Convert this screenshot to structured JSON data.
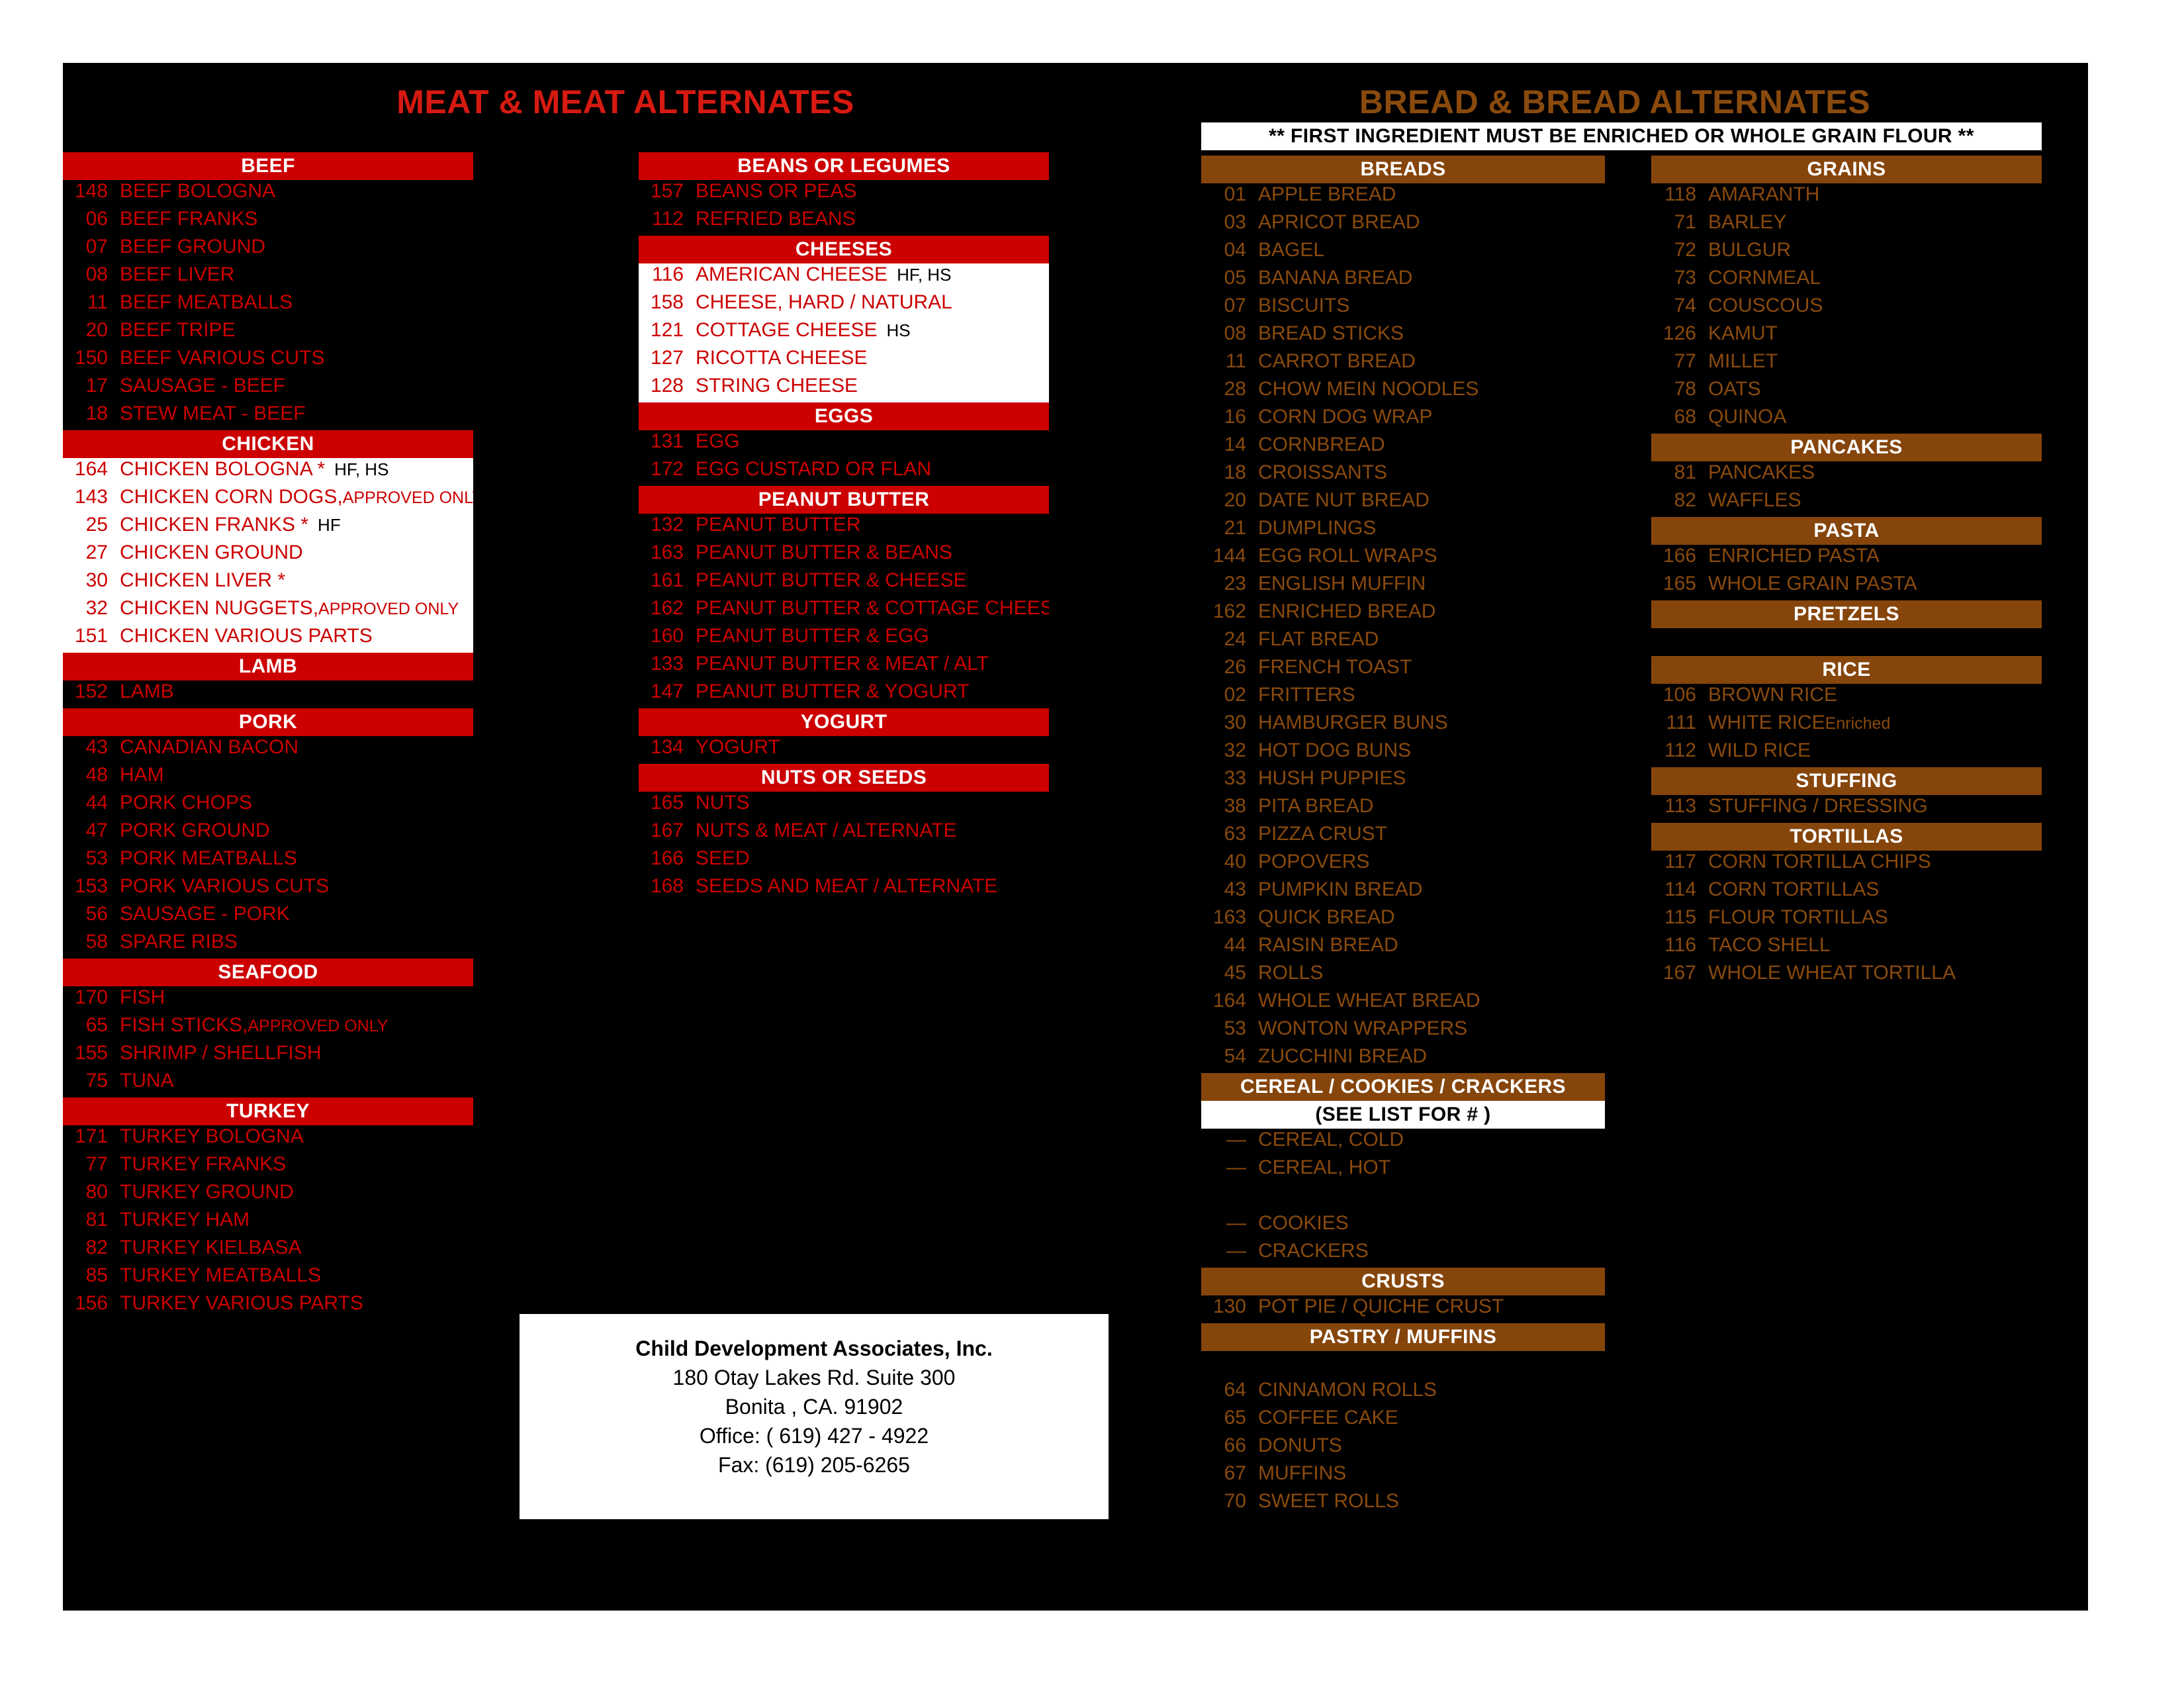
{
  "headers": {
    "meat": "MEAT & MEAT ALTERNATES",
    "bread": "BREAD & BREAD ALTERNATES",
    "bread_note": "** FIRST INGREDIENT MUST BE ENRICHED OR WHOLE GRAIN FLOUR **"
  },
  "colors": {
    "red_accent": "#cc0000",
    "red_text": "#cc0000",
    "brown_accent": "#86450b",
    "brown_text": "#8a4a0d",
    "page_background": "#000000",
    "paper": "#ffffff"
  },
  "columns": {
    "meat_left": [
      {
        "title": "BEEF",
        "style": "red",
        "white_panel": false,
        "items": [
          {
            "num": "148",
            "label": "BEEF BOLOGNA"
          },
          {
            "num": "06",
            "label": "BEEF FRANKS"
          },
          {
            "num": "07",
            "label": "BEEF GROUND"
          },
          {
            "num": "08",
            "label": "BEEF LIVER"
          },
          {
            "num": "11",
            "label": "BEEF MEATBALLS"
          },
          {
            "num": "20",
            "label": "BEEF TRIPE"
          },
          {
            "num": "150",
            "label": "BEEF VARIOUS CUTS"
          },
          {
            "num": "17",
            "label": "SAUSAGE - BEEF"
          },
          {
            "num": "18",
            "label": "STEW MEAT - BEEF"
          }
        ]
      },
      {
        "title": "CHICKEN",
        "style": "red",
        "white_panel": true,
        "items": [
          {
            "num": "164",
            "label": "CHICKEN  BOLOGNA  *",
            "note": "HF, HS"
          },
          {
            "num": "143",
            "label": "CHICKEN  CORN DOGS,",
            "small": "APPROVED ONLY"
          },
          {
            "num": "25",
            "label": "CHICKEN  FRANKS   *",
            "note": "HF"
          },
          {
            "num": "27",
            "label": "CHICKEN  GROUND"
          },
          {
            "num": "30",
            "label": "CHICKEN  LIVER *"
          },
          {
            "num": "32",
            "label": "CHICKEN  NUGGETS,",
            "small": "APPROVED ONLY"
          },
          {
            "num": "151",
            "label": "CHICKEN  VARIOUS PARTS"
          }
        ]
      },
      {
        "title": "LAMB",
        "style": "red",
        "white_panel": false,
        "items": [
          {
            "num": "152",
            "label": "LAMB"
          }
        ]
      },
      {
        "title": "PORK",
        "style": "red",
        "white_panel": false,
        "items": [
          {
            "num": "43",
            "label": "CANADIAN BACON"
          },
          {
            "num": "48",
            "label": "HAM"
          },
          {
            "num": "44",
            "label": "PORK CHOPS"
          },
          {
            "num": "47",
            "label": "PORK GROUND"
          },
          {
            "num": "53",
            "label": "PORK MEATBALLS"
          },
          {
            "num": "153",
            "label": "PORK VARIOUS CUTS"
          },
          {
            "num": "56",
            "label": "SAUSAGE - PORK"
          },
          {
            "num": "58",
            "label": "SPARE RIBS"
          }
        ]
      },
      {
        "title": "SEAFOOD",
        "style": "red",
        "white_panel": false,
        "items": [
          {
            "num": "170",
            "label": "FISH"
          },
          {
            "num": "65",
            "label": "FISH STICKS,",
            "small": "APPROVED  ONLY"
          },
          {
            "num": "155",
            "label": "SHRIMP / SHELLFISH"
          },
          {
            "num": "75",
            "label": "TUNA"
          }
        ]
      },
      {
        "title": "TURKEY",
        "style": "red",
        "white_panel": false,
        "items": [
          {
            "num": "171",
            "label": "TURKEY  BOLOGNA"
          },
          {
            "num": "77",
            "label": "TURKEY  FRANKS"
          },
          {
            "num": "80",
            "label": "TURKEY  GROUND"
          },
          {
            "num": "81",
            "label": "TURKEY  HAM"
          },
          {
            "num": "82",
            "label": "TURKEY KIELBASA"
          },
          {
            "num": "85",
            "label": "TURKEY  MEATBALLS"
          },
          {
            "num": "156",
            "label": "TURKEY  VARIOUS PARTS"
          }
        ]
      }
    ],
    "meat_middle": [
      {
        "title": "BEANS  OR  LEGUMES",
        "style": "red",
        "white_panel": false,
        "items": [
          {
            "num": "157",
            "label": "BEANS  OR  PEAS"
          },
          {
            "num": "112",
            "label": "REFRIED  BEANS"
          }
        ]
      },
      {
        "title": "CHEESES",
        "style": "red",
        "white_panel": true,
        "items": [
          {
            "num": "116",
            "label": "AMERICAN CHEESE",
            "note": "HF, HS"
          },
          {
            "num": "158",
            "label": "CHEESE,  HARD / NATURAL"
          },
          {
            "num": "121",
            "label": "COTTAGE CHEESE",
            "note": "HS"
          },
          {
            "num": "127",
            "label": "RICOTTA  CHEESE"
          },
          {
            "num": "128",
            "label": "STRING  CHEESE"
          }
        ]
      },
      {
        "title": "EGGS",
        "style": "red",
        "white_panel": false,
        "items": [
          {
            "num": "131",
            "label": "EGG"
          },
          {
            "num": "172",
            "label": "EGG  CUSTARD OR FLAN"
          }
        ]
      },
      {
        "title": "PEANUT  BUTTER",
        "style": "red",
        "white_panel": false,
        "items": [
          {
            "num": "132",
            "label": "PEANUT BUTTER"
          },
          {
            "num": "163",
            "label": "PEANUT BUTTER & BEANS"
          },
          {
            "num": "161",
            "label": "PEANUT BUTTER & CHEESE"
          },
          {
            "num": "162",
            "label": "PEANUT BUTTER & COTTAGE CHEESE"
          },
          {
            "num": "160",
            "label": "PEANUT BUTTER & EGG"
          },
          {
            "num": "133",
            "label": "PEANUT BUTTER & MEAT / ALT"
          },
          {
            "num": "147",
            "label": "PEANUT BUTTER & YOGURT"
          }
        ]
      },
      {
        "title": "YOGURT",
        "style": "red",
        "white_panel": false,
        "items": [
          {
            "num": "134",
            "label": "YOGURT"
          }
        ]
      },
      {
        "title": "NUTS  OR  SEEDS",
        "style": "red",
        "white_panel": false,
        "items": [
          {
            "num": "165",
            "label": "NUTS"
          },
          {
            "num": "167",
            "label": "NUTS  & MEAT / ALTERNATE"
          },
          {
            "num": "166",
            "label": "SEED"
          },
          {
            "num": "168",
            "label": "SEEDS AND MEAT / ALTERNATE"
          }
        ]
      }
    ],
    "bread_left": [
      {
        "title": "BREADS",
        "style": "brown",
        "white_panel": false,
        "items": [
          {
            "num": "01",
            "label": "APPLE BREAD"
          },
          {
            "num": "03",
            "label": "APRICOT BREAD"
          },
          {
            "num": "04",
            "label": "BAGEL"
          },
          {
            "num": "05",
            "label": "BANANA BREAD"
          },
          {
            "num": "07",
            "label": "BISCUITS"
          },
          {
            "num": "08",
            "label": "BREAD STICKS"
          },
          {
            "num": "11",
            "label": "CARROT BREAD"
          },
          {
            "num": "28",
            "label": "CHOW MEIN NOODLES"
          },
          {
            "num": "16",
            "label": "CORN DOG WRAP"
          },
          {
            "num": "14",
            "label": "CORNBREAD"
          },
          {
            "num": "18",
            "label": "CROISSANTS"
          },
          {
            "num": "20",
            "label": "DATE NUT BREAD"
          },
          {
            "num": "21",
            "label": "DUMPLINGS"
          },
          {
            "num": "144",
            "label": "EGG ROLL WRAPS"
          },
          {
            "num": "23",
            "label": "ENGLISH MUFFIN"
          },
          {
            "num": "162",
            "label": "ENRICHED BREAD"
          },
          {
            "num": "24",
            "label": "FLAT BREAD"
          },
          {
            "num": "26",
            "label": "FRENCH TOAST"
          },
          {
            "num": "02",
            "label": "FRITTERS"
          },
          {
            "num": "30",
            "label": "HAMBURGER BUNS"
          },
          {
            "num": "32",
            "label": "HOT DOG BUNS"
          },
          {
            "num": "33",
            "label": "HUSH  PUPPIES"
          },
          {
            "num": "38",
            "label": "PITA BREAD"
          },
          {
            "num": "63",
            "label": "PIZZA CRUST"
          },
          {
            "num": "40",
            "label": "POPOVERS"
          },
          {
            "num": "43",
            "label": "PUMPKIN BREAD"
          },
          {
            "num": "163",
            "label": "QUICK BREAD"
          },
          {
            "num": "44",
            "label": "RAISIN BREAD"
          },
          {
            "num": "45",
            "label": "ROLLS"
          },
          {
            "num": "164",
            "label": "WHOLE WHEAT BREAD"
          },
          {
            "num": "53",
            "label": "WONTON WRAPPERS"
          },
          {
            "num": "54",
            "label": "ZUCCHINI BREAD"
          }
        ]
      },
      {
        "title": "CEREAL / COOKIES / CRACKERS",
        "subtitle": "(SEE LIST FOR # )",
        "style": "brown",
        "white_panel": false,
        "items": [
          {
            "num": "—",
            "label": "CEREAL, COLD"
          },
          {
            "num": "—",
            "label": "CEREAL, HOT"
          },
          {
            "num": "",
            "label": ""
          },
          {
            "num": "—",
            "label": "COOKIES"
          },
          {
            "num": "—",
            "label": "CRACKERS"
          }
        ]
      },
      {
        "title": "CRUSTS",
        "style": "brown",
        "white_panel": false,
        "items": [
          {
            "num": "130",
            "label": "POT PIE / QUICHE CRUST"
          }
        ]
      },
      {
        "title": "PASTRY / MUFFINS",
        "style": "brown",
        "white_panel": false,
        "items": [
          {
            "num": "",
            "label": ""
          },
          {
            "num": "64",
            "label": "CINNAMON ROLLS"
          },
          {
            "num": "65",
            "label": "COFFEE CAKE"
          },
          {
            "num": "66",
            "label": "DONUTS"
          },
          {
            "num": "67",
            "label": "MUFFINS"
          },
          {
            "num": "70",
            "label": "SWEET ROLLS"
          }
        ]
      }
    ],
    "bread_right": [
      {
        "title": "GRAINS",
        "style": "brown",
        "white_panel": false,
        "items": [
          {
            "num": "118",
            "label": "AMARANTH"
          },
          {
            "num": "71",
            "label": "BARLEY"
          },
          {
            "num": "72",
            "label": "BULGUR"
          },
          {
            "num": "73",
            "label": "CORNMEAL"
          },
          {
            "num": "74",
            "label": "COUSCOUS"
          },
          {
            "num": "126",
            "label": "KAMUT"
          },
          {
            "num": "77",
            "label": "MILLET"
          },
          {
            "num": "78",
            "label": "OATS"
          },
          {
            "num": "68",
            "label": "QUINOA"
          }
        ]
      },
      {
        "title": "PANCAKES",
        "style": "brown",
        "white_panel": false,
        "items": [
          {
            "num": "81",
            "label": "PANCAKES"
          },
          {
            "num": "82",
            "label": "WAFFLES"
          }
        ]
      },
      {
        "title": "PASTA",
        "style": "brown",
        "white_panel": false,
        "items": [
          {
            "num": "166",
            "label": "ENRICHED  PASTA"
          },
          {
            "num": "165",
            "label": "WHOLE GRAIN PASTA"
          }
        ]
      },
      {
        "title": "PRETZELS",
        "style": "brown",
        "white_panel": false,
        "items": [
          {
            "num": "",
            "label": ""
          }
        ]
      },
      {
        "title": "RICE",
        "style": "brown",
        "white_panel": false,
        "items": [
          {
            "num": "106",
            "label": "BROWN RICE"
          },
          {
            "num": "111",
            "label": "WHITE RICE",
            "small": "Enriched"
          },
          {
            "num": "112",
            "label": "WILD RICE"
          }
        ]
      },
      {
        "title": "STUFFING",
        "style": "brown",
        "white_panel": false,
        "items": [
          {
            "num": "113",
            "label": "STUFFING / DRESSING"
          }
        ]
      },
      {
        "title": "TORTILLAS",
        "style": "brown",
        "white_panel": false,
        "items": [
          {
            "num": "117",
            "label": "CORN TORTILLA  CHIPS"
          },
          {
            "num": "114",
            "label": "CORN TORTILLAS"
          },
          {
            "num": "115",
            "label": "FLOUR TORTILLAS"
          },
          {
            "num": "116",
            "label": "TACO SHELL"
          },
          {
            "num": "167",
            "label": "WHOLE WHEAT TORTILLA"
          }
        ]
      }
    ]
  },
  "contact": {
    "name": "Child Development Associates, Inc.",
    "address1": "180 Otay Lakes  Rd. Suite 300",
    "address2": "Bonita , CA. 91902",
    "office": "Office: ( 619) 427 - 4922",
    "fax": "Fax: (619) 205-6265"
  }
}
